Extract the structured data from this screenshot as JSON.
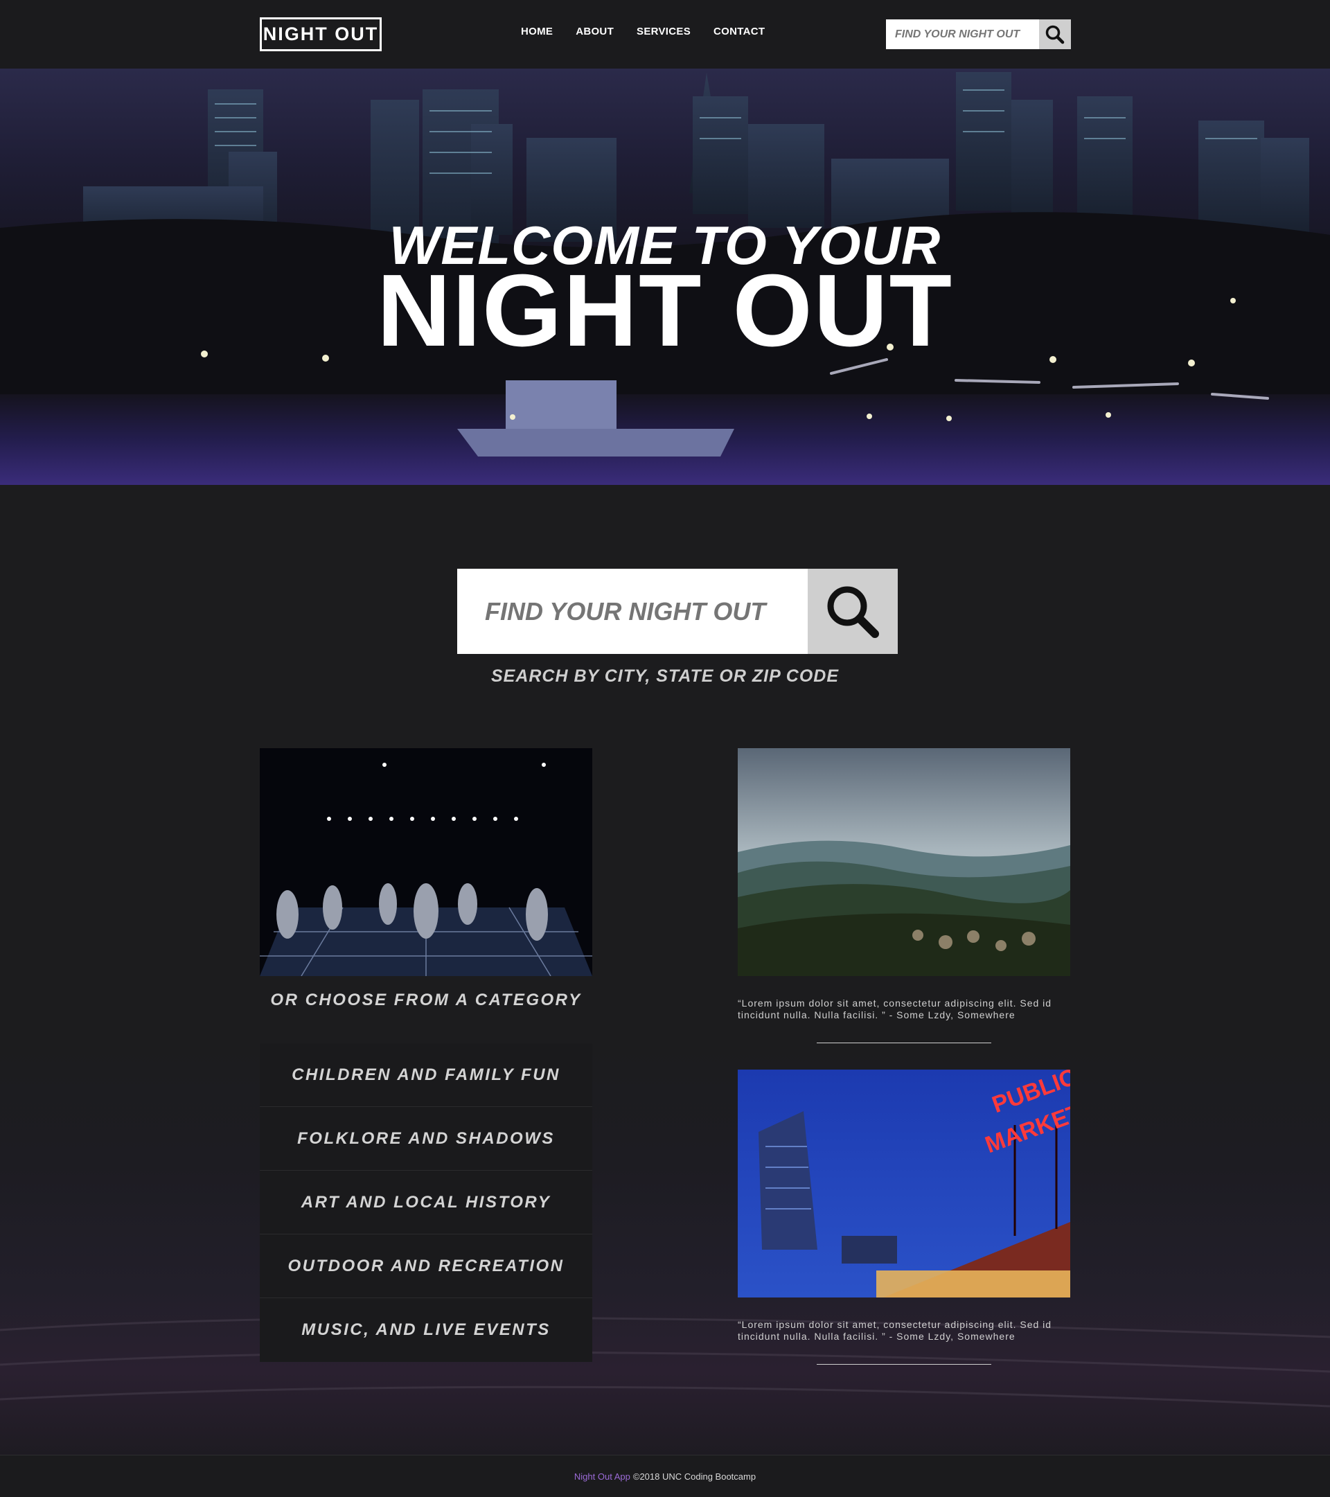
{
  "navbar": {
    "brand": "NIGHT OUT",
    "links": [
      "HOME",
      "ABOUT",
      "SERVICES",
      "CONTACT"
    ],
    "search_placeholder": "FIND YOUR NIGHT OUT"
  },
  "hero": {
    "title_line1": "WELCOME TO YOUR",
    "title_line2": "NIGHT OUT"
  },
  "main_search": {
    "placeholder": "FIND YOUR NIGHT OUT",
    "hint": "SEARCH BY CITY, STATE OR ZIP CODE"
  },
  "categories": {
    "heading": "OR CHOOSE FROM A CATEGORY",
    "items": [
      "CHILDREN AND FAMILY FUN",
      "FOLKLORE AND SHADOWS",
      "ART AND LOCAL HISTORY",
      "OUTDOOR AND RECREATION",
      "MUSIC, AND LIVE EVENTS"
    ]
  },
  "features": [
    {
      "quote": "“Lorem ipsum dolor sit amet, consectetur adipiscing elit. Sed id tincidunt nulla. Nulla facilisi. ” - Some Lzdy, Somewhere"
    },
    {
      "quote": "“Lorem ipsum dolor sit amet, consectetur adipiscing elit. Sed id tincidunt nulla. Nulla facilisi. ” - Some Lzdy, Somewhere"
    }
  ],
  "market_sign": {
    "line1": "PUBLIC",
    "line2": "MARKET"
  },
  "footer": {
    "link": "Night Out App",
    "text": "©2018 UNC Coding Bootcamp"
  },
  "colors": {
    "background": "#1c1c1e",
    "accent_link": "#9b6bd6",
    "search_button": "#cfcfcf"
  },
  "icons": [
    "search-icon"
  ]
}
